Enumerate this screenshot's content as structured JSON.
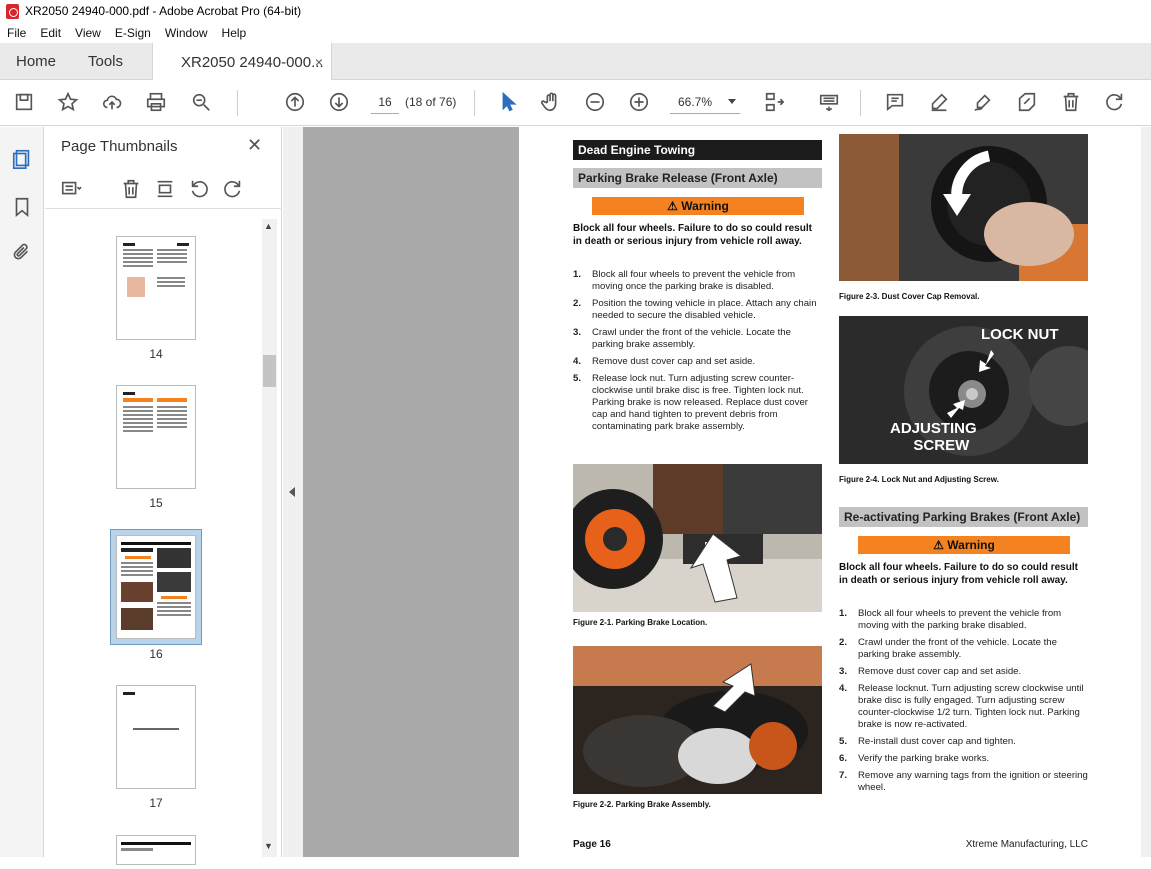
{
  "window": {
    "title": "XR2050 24940-000.pdf - Adobe Acrobat Pro (64-bit)"
  },
  "menu": [
    "File",
    "Edit",
    "View",
    "E-Sign",
    "Window",
    "Help"
  ],
  "tabs": {
    "home": "Home",
    "tools": "Tools",
    "doc": "XR2050 24940-000...",
    "close": "×"
  },
  "toolbar": {
    "page_current": "16",
    "page_count": "(18 of 76)",
    "zoom": "66.7%"
  },
  "thumbs": {
    "title": "Page Thumbnails",
    "close": "✕",
    "pages": [
      "14",
      "15",
      "16",
      "17"
    ]
  },
  "doc": {
    "section_title": "Dead Engine Towing",
    "sub1": "Parking Brake Release (Front Axle)",
    "warning": "⚠ Warning",
    "warn_text": "Block all four wheels.  Failure to do so could result in death or serious injury from vehicle roll away.",
    "steps1": [
      {
        "n": "1.",
        "t": "Block all four wheels to prevent the vehicle from moving once the parking brake is disabled."
      },
      {
        "n": "2.",
        "t": "Position the towing vehicle in place.  Attach any chain needed to secure the disabled vehicle."
      },
      {
        "n": "3.",
        "t": "Crawl under the front of the vehicle.  Locate the parking brake assembly."
      },
      {
        "n": "4.",
        "t": "Remove dust cover cap and set aside."
      },
      {
        "n": "5.",
        "t": "Release lock nut.  Turn adjusting screw counter-clockwise until brake disc is free.  Tighten lock nut.  Parking brake is now released.  Replace dust cover cap and hand tighten to prevent debris from contaminating park brake assembly."
      }
    ],
    "fig1": "Figure 2-1.  Parking Brake Location.",
    "fig2": "Figure 2-2.  Parking Brake Assembly.",
    "fig3": "Figure 2-3.  Dust Cover Cap Removal.",
    "fig4": "Figure 2-4.  Lock Nut and Adjusting Screw.",
    "lock_nut": "LOCK NUT",
    "adj_screw_1": "ADJUSTING",
    "adj_screw_2": "SCREW",
    "sub2": "Re-activating Parking Brakes (Front Axle)",
    "steps2": [
      {
        "n": "1.",
        "t": "Block all four wheels to prevent the vehicle from moving with the parking brake disabled."
      },
      {
        "n": "2.",
        "t": "Crawl under the front of the vehicle.  Locate the parking brake assembly."
      },
      {
        "n": "3.",
        "t": "Remove dust cover cap and set aside."
      },
      {
        "n": "4.",
        "t": "Release locknut.  Turn adjusting screw clockwise until brake disc is fully engaged.  Turn adjusting screw counter-clockwise 1/2 turn.  Tighten lock nut.  Parking brake is now re-activated."
      },
      {
        "n": "5.",
        "t": "Re-install dust cover cap and tighten."
      },
      {
        "n": "6.",
        "t": "Verify the parking brake works."
      },
      {
        "n": "7.",
        "t": "Remove any warning tags from the ignition or steering wheel."
      }
    ],
    "footer_left": "Page 16",
    "footer_right": "Xtreme Manufacturing, LLC"
  }
}
